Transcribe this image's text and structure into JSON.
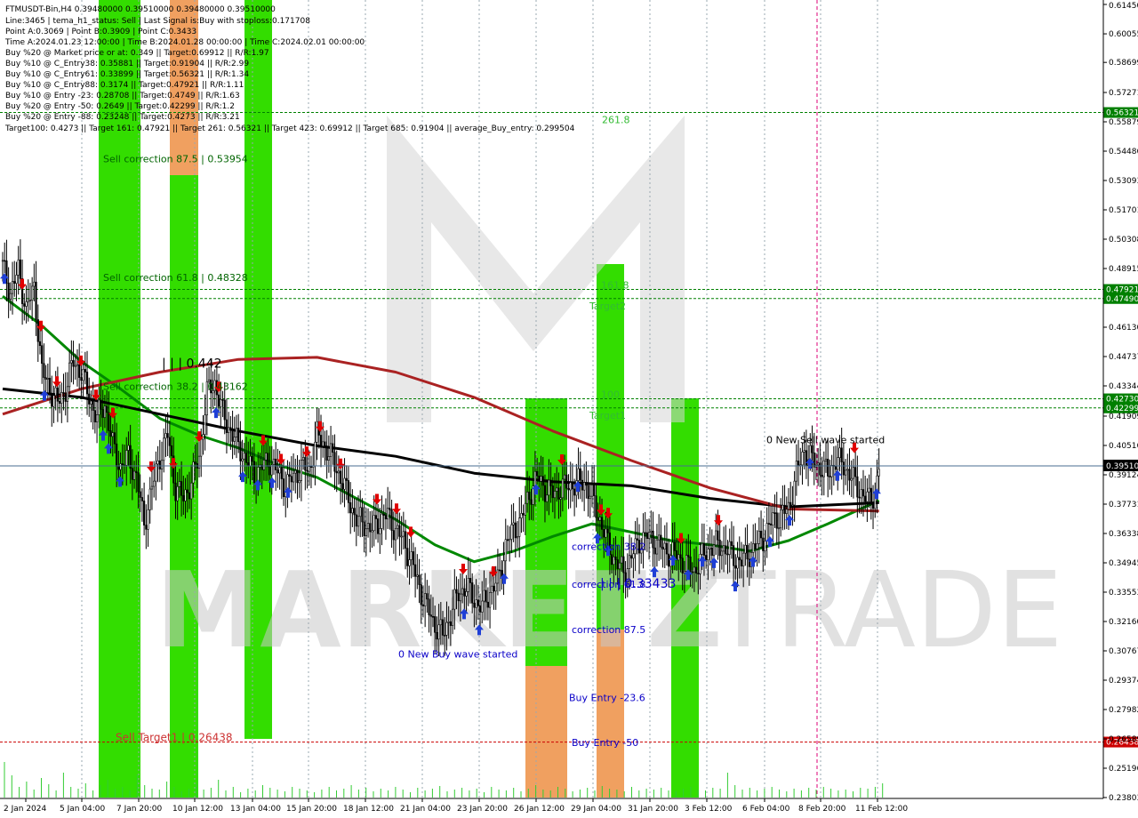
{
  "header": {
    "lines": [
      "FTMUSDT-Bin,H4  0.39480000 0.39510000 0.39480000 0.39510000",
      "Line:3465  | tema_h1_status: Sell  | Last Signal is:Buy with stoploss:0.171708",
      "Point A:0.3069 | Point B:0.3909 | Point C:0.3433",
      "Time A:2024.01.23 12:00:00 | Time B:2024.01.28 00:00:00 | Time C:2024.02.01 00:00:00",
      "Buy %20 @ Market price or at: 0.349 || Target:0.69912 || R/R:1.97",
      "Buy %10 @ C_Entry38: 0.35881 || Target:0.91904 || R/R:2.99",
      "Buy %10 @ C_Entry61: 0.33899 || Target:0.56321 || R/R:1.34",
      "Buy %10 @ C_Entry88: 0.3174 || Target:0.47921 || R/R:1.11",
      "Buy %10 @ Entry -23: 0.28708 || Target:0.4749 || R/R:1.63",
      "Buy %20 @ Entry -50: 0.2649 || Target:0.42299 || R/R:1.2",
      "Buy %20 @ Entry -88: 0.23248 || Target:0.4273 || R/R:3.21",
      "Target100: 0.4273 || Target 161: 0.47921 || Target 261: 0.56321 || Target 423: 0.69912 || Target 685: 0.91904 || average_Buy_entry: 0.299504"
    ]
  },
  "colors": {
    "bull_candle": "#000000",
    "bear_candle": "#000000",
    "zone_green": "#33dd00",
    "zone_orange": "#f0a060",
    "zone_gray": "#555555",
    "ma_fast": "#008800",
    "ma_slow": "#aa2222",
    "ma_mid": "#000000",
    "level_green": "#008000",
    "level_red": "#cc0000",
    "current_price": "#4a6e91",
    "up_arrow": "#1f3fd6",
    "down_arrow": "#e00000",
    "label_blue": "#0a00c8",
    "label_red": "#cc3333",
    "label_green": "#33bb33",
    "watermark": "#c8c8c8"
  },
  "watermark": {
    "text_left": "MARKETZ",
    "text_right": "TRADE"
  },
  "chart_data": {
    "type": "candlestick",
    "symbol": "FTMUSDT-Bin",
    "timeframe": "H4",
    "ylim": [
      0.23803,
      0.6145
    ],
    "y_ticks": [
      0.6145,
      0.60055,
      0.58699,
      0.57271,
      0.55879,
      0.54486,
      0.53093,
      0.51701,
      0.50308,
      0.48915,
      0.4613,
      0.44737,
      0.43344,
      0.41909,
      0.40516,
      0.39124,
      0.37731,
      0.36338,
      0.34945,
      0.33553,
      0.3216,
      0.30767,
      0.29374,
      0.27982,
      0.26589,
      0.25196,
      0.23803
    ],
    "x_labels": [
      "2 Jan 2024",
      "5 Jan 04:00",
      "7 Jan 20:00",
      "10 Jan 12:00",
      "13 Jan 04:00",
      "15 Jan 20:00",
      "18 Jan 12:00",
      "21 Jan 04:00",
      "23 Jan 20:00",
      "26 Jan 12:00",
      "29 Jan 04:00",
      "31 Jan 20:00",
      "3 Feb 12:00",
      "6 Feb 04:00",
      "8 Feb 20:00",
      "11 Feb 12:00"
    ],
    "current_price": "0.39510",
    "price_path": [
      [
        0,
        0.49
      ],
      [
        4,
        0.478
      ],
      [
        8,
        0.488
      ],
      [
        12,
        0.47
      ],
      [
        16,
        0.48
      ],
      [
        20,
        0.44
      ],
      [
        24,
        0.432
      ],
      [
        28,
        0.425
      ],
      [
        32,
        0.432
      ],
      [
        36,
        0.445
      ],
      [
        40,
        0.44
      ],
      [
        44,
        0.428
      ],
      [
        48,
        0.418
      ],
      [
        52,
        0.425
      ],
      [
        56,
        0.405
      ],
      [
        60,
        0.395
      ],
      [
        64,
        0.4
      ],
      [
        68,
        0.39
      ],
      [
        72,
        0.368
      ],
      [
        76,
        0.385
      ],
      [
        80,
        0.4
      ],
      [
        84,
        0.41
      ],
      [
        88,
        0.385
      ],
      [
        92,
        0.38
      ],
      [
        96,
        0.388
      ],
      [
        100,
        0.4
      ],
      [
        104,
        0.43
      ],
      [
        108,
        0.435
      ],
      [
        112,
        0.42
      ],
      [
        116,
        0.412
      ],
      [
        120,
        0.405
      ],
      [
        124,
        0.398
      ],
      [
        128,
        0.392
      ],
      [
        132,
        0.395
      ],
      [
        136,
        0.398
      ],
      [
        140,
        0.392
      ],
      [
        144,
        0.386
      ],
      [
        148,
        0.39
      ],
      [
        152,
        0.395
      ],
      [
        156,
        0.393
      ],
      [
        160,
        0.41
      ],
      [
        164,
        0.405
      ],
      [
        168,
        0.398
      ],
      [
        172,
        0.39
      ],
      [
        176,
        0.38
      ],
      [
        180,
        0.37
      ],
      [
        184,
        0.368
      ],
      [
        188,
        0.365
      ],
      [
        192,
        0.37
      ],
      [
        196,
        0.372
      ],
      [
        200,
        0.365
      ],
      [
        204,
        0.36
      ],
      [
        208,
        0.35
      ],
      [
        212,
        0.338
      ],
      [
        216,
        0.328
      ],
      [
        220,
        0.32
      ],
      [
        224,
        0.315
      ],
      [
        228,
        0.325
      ],
      [
        232,
        0.335
      ],
      [
        236,
        0.338
      ],
      [
        240,
        0.332
      ],
      [
        244,
        0.328
      ],
      [
        248,
        0.336
      ],
      [
        252,
        0.34
      ],
      [
        256,
        0.358
      ],
      [
        260,
        0.365
      ],
      [
        264,
        0.37
      ],
      [
        268,
        0.382
      ],
      [
        272,
        0.39
      ],
      [
        276,
        0.385
      ],
      [
        280,
        0.382
      ],
      [
        284,
        0.385
      ],
      [
        288,
        0.386
      ],
      [
        292,
        0.387
      ],
      [
        296,
        0.388
      ],
      [
        300,
        0.38
      ],
      [
        304,
        0.37
      ],
      [
        308,
        0.358
      ],
      [
        312,
        0.35
      ],
      [
        316,
        0.345
      ],
      [
        320,
        0.352
      ],
      [
        324,
        0.36
      ],
      [
        328,
        0.362
      ],
      [
        332,
        0.36
      ],
      [
        336,
        0.356
      ],
      [
        340,
        0.354
      ],
      [
        344,
        0.352
      ],
      [
        348,
        0.348
      ],
      [
        352,
        0.346
      ],
      [
        356,
        0.352
      ],
      [
        360,
        0.357
      ],
      [
        364,
        0.358
      ],
      [
        368,
        0.356
      ],
      [
        372,
        0.352
      ],
      [
        376,
        0.35
      ],
      [
        380,
        0.354
      ],
      [
        384,
        0.358
      ],
      [
        388,
        0.363
      ],
      [
        392,
        0.37
      ],
      [
        396,
        0.372
      ],
      [
        400,
        0.375
      ],
      [
        404,
        0.392
      ],
      [
        408,
        0.403
      ],
      [
        412,
        0.398
      ],
      [
        416,
        0.395
      ],
      [
        420,
        0.392
      ],
      [
        424,
        0.398
      ],
      [
        428,
        0.396
      ],
      [
        432,
        0.39
      ],
      [
        436,
        0.384
      ],
      [
        440,
        0.379
      ],
      [
        444,
        0.382
      ],
      [
        446,
        0.3951
      ]
    ],
    "moving_averages": [
      {
        "name": "fast",
        "color": "#008800",
        "points": [
          [
            0,
            0.476
          ],
          [
            20,
            0.462
          ],
          [
            40,
            0.445
          ],
          [
            60,
            0.432
          ],
          [
            80,
            0.418
          ],
          [
            100,
            0.41
          ],
          [
            120,
            0.404
          ],
          [
            140,
            0.396
          ],
          [
            160,
            0.39
          ],
          [
            180,
            0.38
          ],
          [
            200,
            0.37
          ],
          [
            220,
            0.358
          ],
          [
            240,
            0.35
          ],
          [
            260,
            0.355
          ],
          [
            280,
            0.362
          ],
          [
            300,
            0.368
          ],
          [
            320,
            0.364
          ],
          [
            340,
            0.36
          ],
          [
            360,
            0.358
          ],
          [
            380,
            0.355
          ],
          [
            400,
            0.36
          ],
          [
            420,
            0.368
          ],
          [
            446,
            0.379
          ]
        ]
      },
      {
        "name": "mid",
        "color": "#000000",
        "points": [
          [
            0,
            0.432
          ],
          [
            40,
            0.428
          ],
          [
            80,
            0.42
          ],
          [
            120,
            0.412
          ],
          [
            160,
            0.405
          ],
          [
            200,
            0.4
          ],
          [
            240,
            0.392
          ],
          [
            280,
            0.388
          ],
          [
            320,
            0.386
          ],
          [
            360,
            0.38
          ],
          [
            400,
            0.376
          ],
          [
            446,
            0.378
          ]
        ]
      },
      {
        "name": "slow",
        "color": "#aa2222",
        "points": [
          [
            0,
            0.42
          ],
          [
            40,
            0.432
          ],
          [
            80,
            0.44
          ],
          [
            120,
            0.446
          ],
          [
            160,
            0.447
          ],
          [
            200,
            0.44
          ],
          [
            240,
            0.428
          ],
          [
            280,
            0.412
          ],
          [
            320,
            0.398
          ],
          [
            360,
            0.385
          ],
          [
            400,
            0.375
          ],
          [
            446,
            0.374
          ]
        ]
      }
    ],
    "levels": [
      {
        "label": "261.8",
        "price": 0.56321,
        "tag": "0.56321",
        "color": "#008000",
        "style": "dashed"
      },
      {
        "label": "161.8",
        "price": 0.47921,
        "tag": "0.47921",
        "color": "#008000",
        "style": "dashed"
      },
      {
        "label": "Target2",
        "price": 0.4749,
        "tag": "0.47490",
        "color": "#008000",
        "style": "dashed"
      },
      {
        "label": "100",
        "price": 0.4273,
        "tag": "0.42730",
        "color": "#008000",
        "style": "dashed"
      },
      {
        "label": "Target1",
        "price": 0.42299,
        "tag": "0.42299",
        "color": "#008000",
        "style": "dashed"
      },
      {
        "label": "Sell Target1 | 0.26438",
        "price": 0.26438,
        "tag": "0.26438",
        "color": "#cc0000",
        "style": "dashed"
      }
    ],
    "zones": [
      {
        "x0": 111,
        "x1": 158,
        "y0": 0,
        "y1": 897,
        "color": "#33dd00"
      },
      {
        "x0": 191,
        "x1": 223,
        "y0": 0,
        "y1": 897,
        "color": "#33dd00"
      },
      {
        "x0": 191,
        "x1": 223,
        "y0": 0,
        "y1": 197,
        "color": "#f0a060"
      },
      {
        "x0": 275,
        "x1": 306,
        "y0": 0,
        "y1": 831,
        "color": "#33dd00"
      },
      {
        "x0": 591,
        "x1": 638,
        "y0": 448,
        "y1": 749,
        "color": "#33dd00"
      },
      {
        "x0": 591,
        "x1": 638,
        "y0": 749,
        "y1": 897,
        "color": "#f0a060"
      },
      {
        "x0": 671,
        "x1": 702,
        "y0": 297,
        "y1": 708,
        "color": "#33dd00"
      },
      {
        "x0": 671,
        "x1": 702,
        "y0": 708,
        "y1": 897,
        "color": "#f0a060"
      },
      {
        "x0": 755,
        "x1": 786,
        "y0": 448,
        "y1": 897,
        "color": "#33dd00"
      }
    ],
    "annotations": [
      {
        "text": "Sell correction 87.5 | 0.53954",
        "x": 116,
        "price": 0.53954,
        "color": "#006400"
      },
      {
        "text": "Sell correction 61.8 | 0.48328",
        "x": 116,
        "price": 0.48328,
        "color": "#006400"
      },
      {
        "text": "Sell correction 38.2 | 0.43162",
        "x": 116,
        "price": 0.43162,
        "color": "#006400"
      },
      {
        "text": "| | | 0.442",
        "x": 182,
        "price": 0.442,
        "color": "#000000"
      },
      {
        "text": "0 New Sell wave started",
        "x": 862,
        "price": 0.4062,
        "color": "#000000"
      },
      {
        "text": "correction 38.2",
        "x": 643,
        "price": 0.3556,
        "color": "#0a00c8"
      },
      {
        "text": "correction 61.8",
        "x": 643,
        "price": 0.3376,
        "color": "#0a00c8"
      },
      {
        "text": "| | | 0.33433",
        "x": 675,
        "price": 0.3376,
        "color": "#0a00c8"
      },
      {
        "text": "correction 87.5",
        "x": 643,
        "price": 0.3162,
        "color": "#0a00c8"
      },
      {
        "text": "0 New Buy wave started",
        "x": 448,
        "price": 0.3045,
        "color": "#0a00c8"
      },
      {
        "text": "Buy Entry -23.6",
        "x": 640,
        "price": 0.2838,
        "color": "#0a00c8"
      },
      {
        "text": "Buy Entry -50",
        "x": 643,
        "price": 0.2625,
        "color": "#0a00c8"
      }
    ],
    "vertical_lines": [
      {
        "x": 919,
        "color": "#dd0077"
      }
    ],
    "up_arrows_x": [
      5,
      50,
      116,
      122,
      135,
      243,
      273,
      290,
      306,
      324,
      522,
      539,
      567,
      603,
      650,
      672,
      684,
      736,
      757,
      774,
      790,
      803,
      827,
      847,
      866,
      888,
      911,
      942,
      986
    ],
    "down_arrows_x": [
      25,
      46,
      64,
      91,
      108,
      127,
      170,
      195,
      224,
      246,
      296,
      316,
      345,
      360,
      383,
      424,
      446,
      462,
      521,
      555,
      632,
      676,
      684,
      766,
      808,
      961
    ],
    "volume_bars": [
      40,
      25,
      12,
      18,
      9,
      22,
      15,
      8,
      28,
      12,
      10,
      16,
      8,
      14,
      20,
      10,
      12,
      8,
      26,
      14,
      10,
      9,
      18,
      12,
      7,
      10,
      15,
      9,
      11,
      20,
      8,
      12,
      6,
      10,
      8,
      14,
      11,
      9,
      7,
      12,
      10,
      8,
      6,
      9,
      12,
      8,
      10,
      14,
      9,
      11,
      7,
      10,
      8,
      12,
      9,
      6,
      11,
      8,
      10,
      13,
      7,
      9,
      11,
      8,
      10,
      6,
      12,
      9,
      8,
      11,
      7,
      10,
      14,
      9,
      8,
      12,
      10,
      7,
      9,
      11,
      8,
      13,
      10,
      9,
      7,
      12,
      8,
      10,
      9,
      11,
      8,
      7,
      10,
      12,
      9,
      8,
      11,
      10,
      28,
      14,
      9,
      11,
      8,
      10,
      12,
      9,
      7,
      10,
      8,
      11,
      9,
      12,
      10,
      8,
      9,
      7,
      11,
      10,
      12,
      16
    ]
  }
}
